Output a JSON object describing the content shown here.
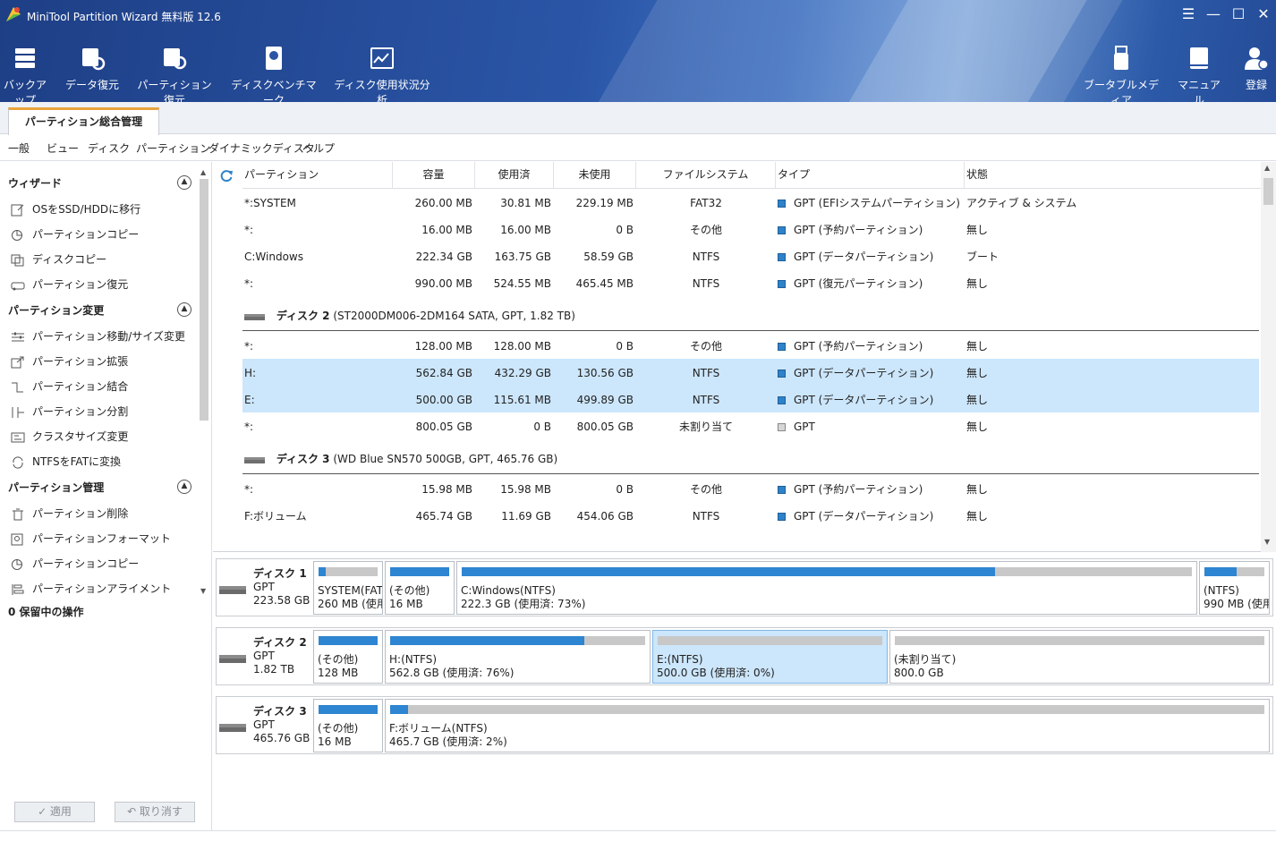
{
  "window": {
    "title": "MiniTool Partition Wizard 無料版 12.6"
  },
  "toolbar": {
    "left": [
      {
        "label": "バックアップ",
        "icon": "backup-icon"
      },
      {
        "label": "データ復元",
        "icon": "data-recovery-icon"
      },
      {
        "label": "パーティション復元",
        "icon": "partition-recovery-icon"
      },
      {
        "label": "ディスクベンチマーク",
        "icon": "disk-benchmark-icon"
      },
      {
        "label": "ディスク使用状況分析",
        "icon": "space-analyzer-icon"
      }
    ],
    "right": [
      {
        "label": "ブータブルメディア",
        "icon": "bootable-media-icon"
      },
      {
        "label": "マニュアル",
        "icon": "manual-icon"
      },
      {
        "label": "登録",
        "icon": "register-icon"
      }
    ]
  },
  "tab": {
    "label": "パーティション総合管理"
  },
  "menu": [
    "一般",
    "ビュー",
    "ディスク",
    "パーティション",
    "ダイナミックディスク",
    "ヘルプ"
  ],
  "sidebar": {
    "sections": [
      {
        "title": "ウィザード",
        "items": [
          "OSをSSD/HDDに移行",
          "パーティションコピー",
          "ディスクコピー",
          "パーティション復元"
        ]
      },
      {
        "title": "パーティション変更",
        "items": [
          "パーティション移動/サイズ変更",
          "パーティション拡張",
          "パーティション結合",
          "パーティション分割",
          "クラスタサイズ変更",
          "NTFSをFATに変換"
        ]
      },
      {
        "title": "パーティション管理",
        "items": [
          "パーティション削除",
          "パーティションフォーマット",
          "パーティションコピー",
          "パーティションアライメント"
        ]
      }
    ],
    "pending": "0 保留中の操作",
    "apply_label": "✓ 適用",
    "undo_label": "↶ 取り消す"
  },
  "table": {
    "columns": [
      "パーティション",
      "容量",
      "使用済",
      "未使用",
      "ファイルシステム",
      "タイプ",
      "状態"
    ],
    "disk1_rows": [
      {
        "name": "*:SYSTEM",
        "cap": "260.00 MB",
        "used": "30.81 MB",
        "free": "229.19 MB",
        "fs": "FAT32",
        "type": "GPT (EFIシステムパーティション)",
        "status": "アクティブ & システム"
      },
      {
        "name": "*:",
        "cap": "16.00 MB",
        "used": "16.00 MB",
        "free": "0 B",
        "fs": "その他",
        "type": "GPT (予約パーティション)",
        "status": "無し"
      },
      {
        "name": "C:Windows",
        "cap": "222.34 GB",
        "used": "163.75 GB",
        "free": "58.59 GB",
        "fs": "NTFS",
        "type": "GPT (データパーティション)",
        "status": "ブート"
      },
      {
        "name": "*:",
        "cap": "990.00 MB",
        "used": "524.55 MB",
        "free": "465.45 MB",
        "fs": "NTFS",
        "type": "GPT (復元パーティション)",
        "status": "無し"
      }
    ],
    "disk2_header": {
      "name": "ディスク 2",
      "desc": "(ST2000DM006-2DM164 SATA, GPT, 1.82 TB)"
    },
    "disk2_rows": [
      {
        "name": "*:",
        "cap": "128.00 MB",
        "used": "128.00 MB",
        "free": "0 B",
        "fs": "その他",
        "type": "GPT (予約パーティション)",
        "status": "無し"
      },
      {
        "name": "H:",
        "cap": "562.84 GB",
        "used": "432.29 GB",
        "free": "130.56 GB",
        "fs": "NTFS",
        "type": "GPT (データパーティション)",
        "status": "無し"
      },
      {
        "name": "E:",
        "cap": "500.00 GB",
        "used": "115.61 MB",
        "free": "499.89 GB",
        "fs": "NTFS",
        "type": "GPT (データパーティション)",
        "status": "無し"
      },
      {
        "name": "*:",
        "cap": "800.05 GB",
        "used": "0 B",
        "free": "800.05 GB",
        "fs": "未割り当て",
        "type": "GPT",
        "status": "無し"
      }
    ],
    "disk3_header": {
      "name": "ディスク 3",
      "desc": "(WD Blue SN570 500GB, GPT, 465.76 GB)"
    },
    "disk3_rows": [
      {
        "name": "*:",
        "cap": "15.98 MB",
        "used": "15.98 MB",
        "free": "0 B",
        "fs": "その他",
        "type": "GPT (予約パーティション)",
        "status": "無し"
      },
      {
        "name": "F:ボリューム",
        "cap": "465.74 GB",
        "used": "11.69 GB",
        "free": "454.06 GB",
        "fs": "NTFS",
        "type": "GPT (データパーティション)",
        "status": "無し"
      }
    ]
  },
  "diskmap": [
    {
      "name": "ディスク 1",
      "style": "GPT",
      "size": "223.58 GB",
      "parts": [
        {
          "l1": "SYSTEM(FAT3",
          "l2": "260 MB (使用",
          "used": 0.12
        },
        {
          "l1": "(その他)",
          "l2": "16 MB",
          "used": 1.0
        },
        {
          "l1": "C:Windows(NTFS)",
          "l2": "222.3 GB (使用済: 73%)",
          "used": 0.73
        },
        {
          "l1": "(NTFS)",
          "l2": "990 MB (使用",
          "used": 0.53
        }
      ]
    },
    {
      "name": "ディスク 2",
      "style": "GPT",
      "size": "1.82 TB",
      "parts": [
        {
          "l1": "(その他)",
          "l2": "128 MB",
          "used": 1.0
        },
        {
          "l1": "H:(NTFS)",
          "l2": "562.8 GB (使用済: 76%)",
          "used": 0.76
        },
        {
          "l1": "E:(NTFS)",
          "l2": "500.0 GB (使用済: 0%)",
          "used": 0.0
        },
        {
          "l1": "(未割り当て)",
          "l2": "800.0 GB",
          "used": 0.0
        }
      ]
    },
    {
      "name": "ディスク 3",
      "style": "GPT",
      "size": "465.76 GB",
      "parts": [
        {
          "l1": "(その他)",
          "l2": "16 MB",
          "used": 1.0
        },
        {
          "l1": "F:ボリューム(NTFS)",
          "l2": "465.7 GB (使用済: 2%)",
          "used": 0.02
        }
      ]
    }
  ]
}
